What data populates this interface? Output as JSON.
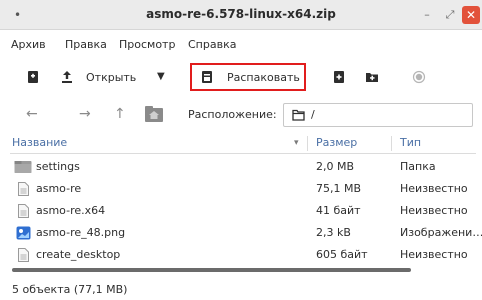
{
  "window": {
    "title": "asmo-re-6.578-linux-x64.zip",
    "menu_dot": "•",
    "minimize_glyph": "–",
    "maximize_glyph": "⤢",
    "close_glyph": "✕"
  },
  "menu": [
    "Архив",
    "Правка",
    "Просмотр",
    "Справка"
  ],
  "toolbar": {
    "open_label": "Открыть",
    "dropdown_glyph": "▼",
    "extract_label": "Распаковать"
  },
  "location": {
    "label": "Расположение:",
    "path": "/"
  },
  "columns": {
    "name": "Название",
    "size": "Размер",
    "type": "Тип",
    "sort_glyph": "▾"
  },
  "files": [
    {
      "name": "settings",
      "size": "2,0 MB",
      "type": "Папка",
      "icon": "folder-icon"
    },
    {
      "name": "asmo-re",
      "size": "75,1 MB",
      "type": "Неизвестно",
      "icon": "file-icon"
    },
    {
      "name": "asmo-re.x64",
      "size": "41 байт",
      "type": "Неизвестно",
      "icon": "file-icon"
    },
    {
      "name": "asmo-re_48.png",
      "size": "2,3 kB",
      "type": "Изображени…",
      "icon": "image-icon"
    },
    {
      "name": "create_desktop",
      "size": "605 байт",
      "type": "Неизвестно",
      "icon": "file-icon"
    }
  ],
  "status": "5 объекта (77,1 MB)",
  "colors": {
    "accent_border": "#e11d1d",
    "header_text": "#4a6fa5",
    "close_button": "#e2523b"
  }
}
